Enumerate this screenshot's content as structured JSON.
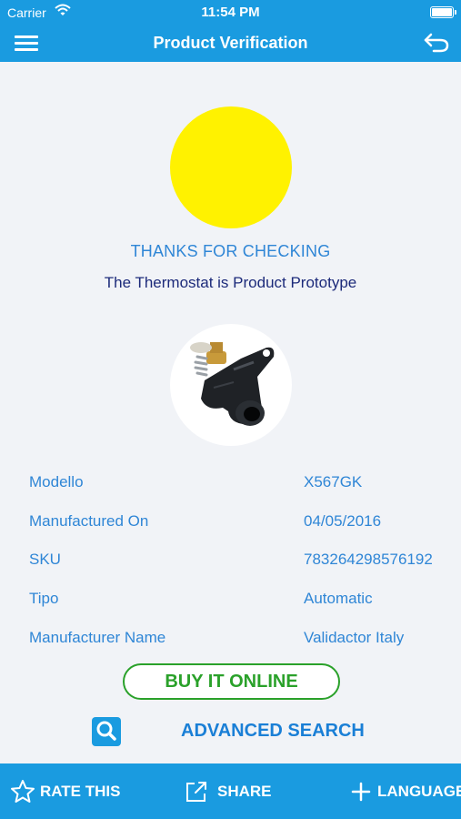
{
  "status_bar": {
    "carrier": "Carrier",
    "time": "11:54 PM"
  },
  "navbar": {
    "title": "Product Verification",
    "menu_icon": "hamburger-menu-icon",
    "back_icon": "undo-back-icon"
  },
  "result": {
    "indicator_color": "#fff200",
    "thanks": "THANKS FOR CHECKING",
    "verdict": "The Thermostat is Product Prototype"
  },
  "details": [
    {
      "label": "Modello",
      "value": "X567GK"
    },
    {
      "label": "Manufactured On",
      "value": "04/05/2016"
    },
    {
      "label": "SKU",
      "value": "783264298576192"
    },
    {
      "label": "Tipo",
      "value": "Automatic"
    },
    {
      "label": "Manufacturer Name",
      "value": "Validactor Italy"
    }
  ],
  "actions": {
    "buy": "BUY IT ONLINE",
    "advanced_search": "ADVANCED SEARCH"
  },
  "bottom_bar": [
    {
      "label": "RATE THIS",
      "icon": "star-icon"
    },
    {
      "label": "SHARE",
      "icon": "share-icon"
    },
    {
      "label": "LANGUAGE",
      "icon": "plus-icon"
    }
  ],
  "colors": {
    "primary": "#1a9be0",
    "text_blue": "#2f86d6",
    "dark_blue": "#1c2a7a",
    "green": "#2aa12a"
  }
}
